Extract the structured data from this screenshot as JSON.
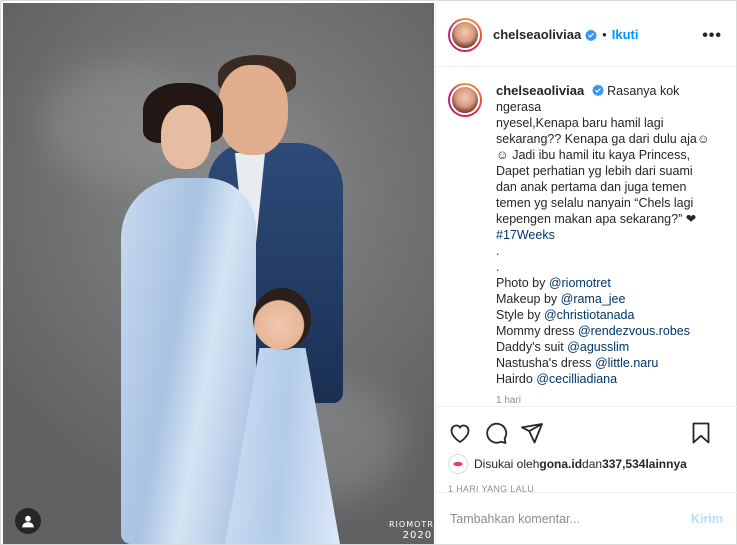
{
  "post": {
    "username": "chelseaoliviaa",
    "follow_label": "Ikuti",
    "dot": "•",
    "more_label": "•••",
    "caption_lines": [
      "Rasanya kok ngerasa",
      "nyesel,Kenapa baru hamil lagi",
      "sekarang?? Kenapa ga dari dulu aja☺",
      "☺ Jadi ibu hamil itu kaya Princess,",
      "Dapet perhatian yg lebih dari suami",
      "dan anak pertama dan juga temen",
      "temen yg selalu nanyain “Chels lagi",
      "kepengen makan apa sekarang?” ❤",
      "#17Weeks",
      ".",
      "."
    ],
    "credits": [
      {
        "label": "Photo by ",
        "tag": "@riomotret"
      },
      {
        "label": "Makeup by ",
        "tag": "@rama_jee"
      },
      {
        "label": "Style by ",
        "tag": "@christiotanada"
      },
      {
        "label": "Mommy dress ",
        "tag": "@rendezvous.robes"
      },
      {
        "label": "Daddy's suit ",
        "tag": "@agusslim"
      },
      {
        "label": "Nastusha's dress ",
        "tag": "@little.naru"
      },
      {
        "label": "Hairdo ",
        "tag": "@cecilliadiana"
      }
    ],
    "time": "1 hari",
    "liked_by_prefix": "Disukai oleh ",
    "liked_by_user": "gona.id",
    "liked_by_mid": " dan ",
    "like_count": "337,534",
    "liked_by_suffix": " lainnya",
    "ago": "1 HARI YANG LALU",
    "comment_placeholder": "Tambahkan komentar...",
    "post_label": "Kirim"
  },
  "photo": {
    "watermark": "RIOMOTRET",
    "watermark_year": "2020"
  },
  "icons": [
    "heart-icon",
    "comment-icon",
    "share-icon",
    "bookmark-icon",
    "verified-icon",
    "user-tag-icon"
  ],
  "colors": {
    "accent": "#0095f6",
    "tag": "#00376b",
    "muted": "#8e8e8e"
  }
}
